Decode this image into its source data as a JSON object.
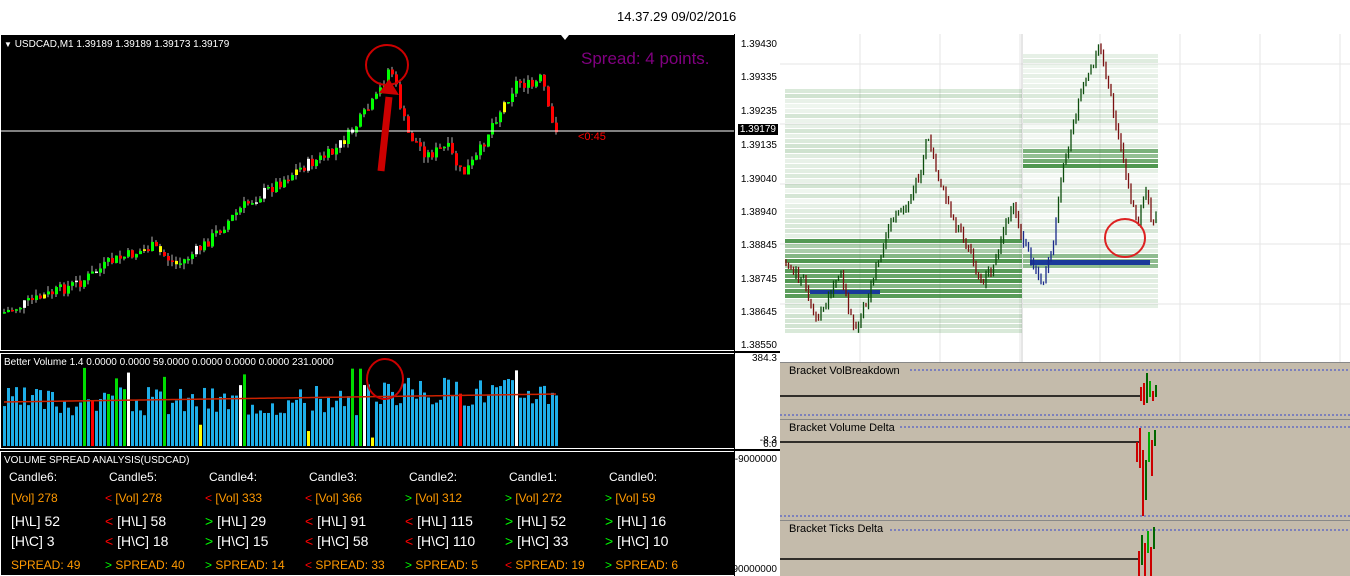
{
  "header": {
    "timestamp": "14.37.29 09/02/2016"
  },
  "main_chart": {
    "title": "USDCAD,M1  1.39189 1.39189 1.39173 1.39179",
    "spread_text": "Spread: 4 points.",
    "countdown": "<0:45",
    "current_price": "1.39179",
    "price_ticks": [
      "1.39430",
      "1.39335",
      "1.39235",
      "1.39135",
      "1.39040",
      "1.38940",
      "1.38845",
      "1.38745",
      "1.38645",
      "1.38550"
    ],
    "colors": {
      "bull": "#00ff00",
      "bear": "#ff0000",
      "annot": "#cc0000",
      "spread": "#800080"
    }
  },
  "volume_indicator": {
    "title": "Better Volume 1.4 0.0000 0.0000 59.0000 0.0000 0.0000 0.0000 231.0000",
    "ticks": [
      "384.3",
      "6.0",
      "-8.3"
    ]
  },
  "vsa": {
    "title": "VOLUME SPREAD ANALYSIS(USDCAD)",
    "axis_ticks": [
      "-9000000",
      "90000000"
    ],
    "columns": [
      {
        "name": "Candle6:",
        "vol": {
          "mark": "",
          "text": "[Vol]  278"
        },
        "hl": {
          "mark": "",
          "text": "[H\\L]  52"
        },
        "hc": {
          "mark": "",
          "text": "[H\\C]  3"
        },
        "spread": {
          "mark": "",
          "text": "SPREAD:  49"
        }
      },
      {
        "name": "Candle5:",
        "vol": {
          "mark": "<",
          "text": "[Vol]  278"
        },
        "hl": {
          "mark": "<",
          "text": "[H\\L]  58"
        },
        "hc": {
          "mark": "<",
          "text": "[H\\C]  18"
        },
        "spread": {
          "mark": ">",
          "text": "SPREAD:  40"
        }
      },
      {
        "name": "Candle4:",
        "vol": {
          "mark": "<",
          "text": "[Vol]  333"
        },
        "hl": {
          "mark": ">",
          "text": "[H\\L]  29"
        },
        "hc": {
          "mark": ">",
          "text": "[H\\C]  15"
        },
        "spread": {
          "mark": ">",
          "text": "SPREAD:  14"
        }
      },
      {
        "name": "Candle3:",
        "vol": {
          "mark": "<",
          "text": "[Vol]  366"
        },
        "hl": {
          "mark": "<",
          "text": "[H\\L]  91"
        },
        "hc": {
          "mark": "<",
          "text": "[H\\C]  58"
        },
        "spread": {
          "mark": "<",
          "text": "SPREAD:  33"
        }
      },
      {
        "name": "Candle2:",
        "vol": {
          "mark": ">",
          "text": "[Vol]  312"
        },
        "hl": {
          "mark": "<",
          "text": "[H\\L]  115"
        },
        "hc": {
          "mark": "<",
          "text": "[H\\C]  110"
        },
        "spread": {
          "mark": ">",
          "text": "SPREAD:  5"
        }
      },
      {
        "name": "Candle1:",
        "vol": {
          "mark": ">",
          "text": "[Vol]  272"
        },
        "hl": {
          "mark": ">",
          "text": "[H\\L]  52"
        },
        "hc": {
          "mark": ">",
          "text": "[H\\C]  33"
        },
        "spread": {
          "mark": "<",
          "text": "SPREAD:  19"
        }
      },
      {
        "name": "Candle0:",
        "vol": {
          "mark": ">",
          "text": "[Vol]  59"
        },
        "hl": {
          "mark": ">",
          "text": "[H\\L]  16"
        },
        "hc": {
          "mark": ">",
          "text": "[H\\C]  10"
        },
        "spread": {
          "mark": ">",
          "text": "SPREAD:  6"
        }
      }
    ],
    "colors": {
      "vol": "#ff9900",
      "hl": "#ffffff",
      "spread": "#ff9900",
      "up": "#00ff00",
      "down": "#ff0000"
    }
  },
  "right_panel": {
    "brackets": [
      {
        "label": "Bracket VolBreakdown"
      },
      {
        "label": "Bracket Volume Delta"
      },
      {
        "label": "Bracket Ticks Delta"
      }
    ]
  }
}
